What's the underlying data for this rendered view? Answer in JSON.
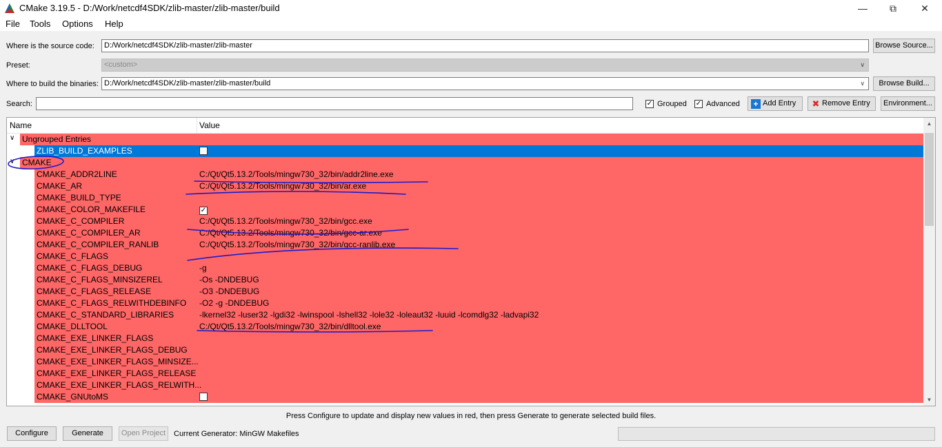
{
  "window": {
    "title": "CMake 3.19.5 - D:/Work/netcdf4SDK/zlib-master/zlib-master/build",
    "minimize": "—",
    "restore": "⧉",
    "close": "✕"
  },
  "menu": [
    "File",
    "Tools",
    "Options",
    "Help"
  ],
  "source": {
    "label": "Where is the source code:",
    "value": "D:/Work/netcdf4SDK/zlib-master/zlib-master",
    "browse": "Browse Source..."
  },
  "preset": {
    "label": "Preset:",
    "value": "<custom>"
  },
  "build": {
    "label": "Where to build the binaries:",
    "value": "D:/Work/netcdf4SDK/zlib-master/zlib-master/build",
    "browse": "Browse Build..."
  },
  "search": {
    "label": "Search:",
    "value": "",
    "grouped": "Grouped",
    "advanced": "Advanced",
    "add_entry": "Add Entry",
    "remove_entry": "Remove Entry",
    "environment": "Environment..."
  },
  "table": {
    "col_name": "Name",
    "col_value": "Value",
    "rows": [
      {
        "kind": "group",
        "name": "Ungrouped Entries"
      },
      {
        "kind": "item",
        "name": "ZLIB_BUILD_EXAMPLES",
        "type": "bool",
        "checked": false,
        "selected": true
      },
      {
        "kind": "group",
        "name": "CMAKE"
      },
      {
        "kind": "item",
        "name": "CMAKE_ADDR2LINE",
        "value": "C:/Qt/Qt5.13.2/Tools/mingw730_32/bin/addr2line.exe"
      },
      {
        "kind": "item",
        "name": "CMAKE_AR",
        "value": "C:/Qt/Qt5.13.2/Tools/mingw730_32/bin/ar.exe"
      },
      {
        "kind": "item",
        "name": "CMAKE_BUILD_TYPE",
        "value": ""
      },
      {
        "kind": "item",
        "name": "CMAKE_COLOR_MAKEFILE",
        "type": "bool",
        "checked": true
      },
      {
        "kind": "item",
        "name": "CMAKE_C_COMPILER",
        "value": "C:/Qt/Qt5.13.2/Tools/mingw730_32/bin/gcc.exe"
      },
      {
        "kind": "item",
        "name": "CMAKE_C_COMPILER_AR",
        "value": "C:/Qt/Qt5.13.2/Tools/mingw730_32/bin/gcc-ar.exe"
      },
      {
        "kind": "item",
        "name": "CMAKE_C_COMPILER_RANLIB",
        "value": "C:/Qt/Qt5.13.2/Tools/mingw730_32/bin/gcc-ranlib.exe"
      },
      {
        "kind": "item",
        "name": "CMAKE_C_FLAGS",
        "value": ""
      },
      {
        "kind": "item",
        "name": "CMAKE_C_FLAGS_DEBUG",
        "value": "-g"
      },
      {
        "kind": "item",
        "name": "CMAKE_C_FLAGS_MINSIZEREL",
        "value": "-Os -DNDEBUG"
      },
      {
        "kind": "item",
        "name": "CMAKE_C_FLAGS_RELEASE",
        "value": "-O3 -DNDEBUG"
      },
      {
        "kind": "item",
        "name": "CMAKE_C_FLAGS_RELWITHDEBINFO",
        "value": "-O2 -g -DNDEBUG"
      },
      {
        "kind": "item",
        "name": "CMAKE_C_STANDARD_LIBRARIES",
        "value": "-lkernel32 -luser32 -lgdi32 -lwinspool -lshell32 -lole32 -loleaut32 -luuid -lcomdlg32 -ladvapi32"
      },
      {
        "kind": "item",
        "name": "CMAKE_DLLTOOL",
        "value": "C:/Qt/Qt5.13.2/Tools/mingw730_32/bin/dlltool.exe"
      },
      {
        "kind": "item",
        "name": "CMAKE_EXE_LINKER_FLAGS",
        "value": ""
      },
      {
        "kind": "item",
        "name": "CMAKE_EXE_LINKER_FLAGS_DEBUG",
        "value": ""
      },
      {
        "kind": "item",
        "name": "CMAKE_EXE_LINKER_FLAGS_MINSIZE...",
        "value": ""
      },
      {
        "kind": "item",
        "name": "CMAKE_EXE_LINKER_FLAGS_RELEASE",
        "value": ""
      },
      {
        "kind": "item",
        "name": "CMAKE_EXE_LINKER_FLAGS_RELWITH...",
        "value": ""
      },
      {
        "kind": "item",
        "name": "CMAKE_GNUtoMS",
        "type": "bool",
        "checked": false
      }
    ]
  },
  "status_message": "Press Configure to update and display new values in red, then press Generate to generate selected build files.",
  "bottom": {
    "configure": "Configure",
    "generate": "Generate",
    "open_project": "Open Project",
    "generator": "Current Generator: MinGW Makefiles"
  },
  "colors": {
    "new_entry_red": "#ff6666",
    "selection_blue": "#0078d7",
    "annotation_ink": "#1a1acc"
  }
}
